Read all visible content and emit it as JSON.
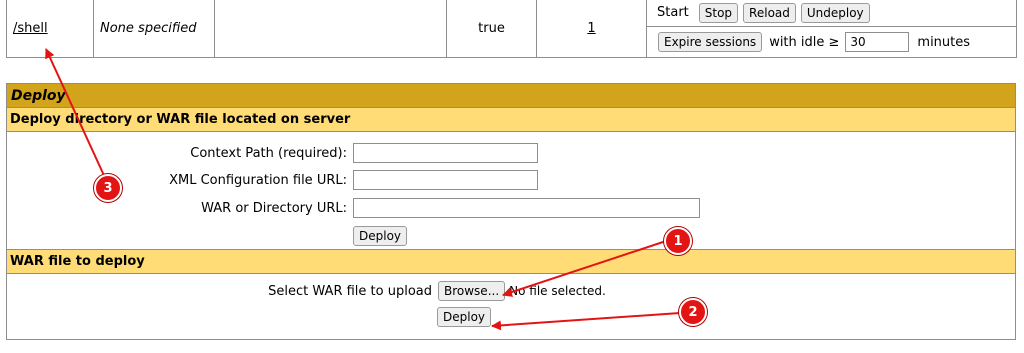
{
  "app_row": {
    "path": "/shell",
    "display_name": "None specified",
    "description": "",
    "running": "true",
    "sessions": "1",
    "commands": {
      "start": "Start",
      "stop": "Stop",
      "reload": "Reload",
      "undeploy": "Undeploy",
      "expire_sessions": "Expire sessions",
      "with_idle": "with idle ≥",
      "idle_value": "30",
      "minutes": "minutes"
    }
  },
  "deploy": {
    "title": "Deploy",
    "server_section": {
      "title": "Deploy directory or WAR file located on server",
      "context_path_label": "Context Path (required):",
      "context_path_value": "",
      "xml_config_label": "XML Configuration file URL:",
      "xml_config_value": "",
      "war_dir_label": "WAR or Directory URL:",
      "war_dir_value": "",
      "deploy_button": "Deploy"
    },
    "upload_section": {
      "title": "WAR file to deploy",
      "select_label": "Select WAR file to upload",
      "browse_button": "Browse...",
      "file_status": "No file selected.",
      "deploy_button": "Deploy"
    }
  },
  "annotations": {
    "badge1": "1",
    "badge2": "2",
    "badge3": "3",
    "color": "#e31414"
  }
}
